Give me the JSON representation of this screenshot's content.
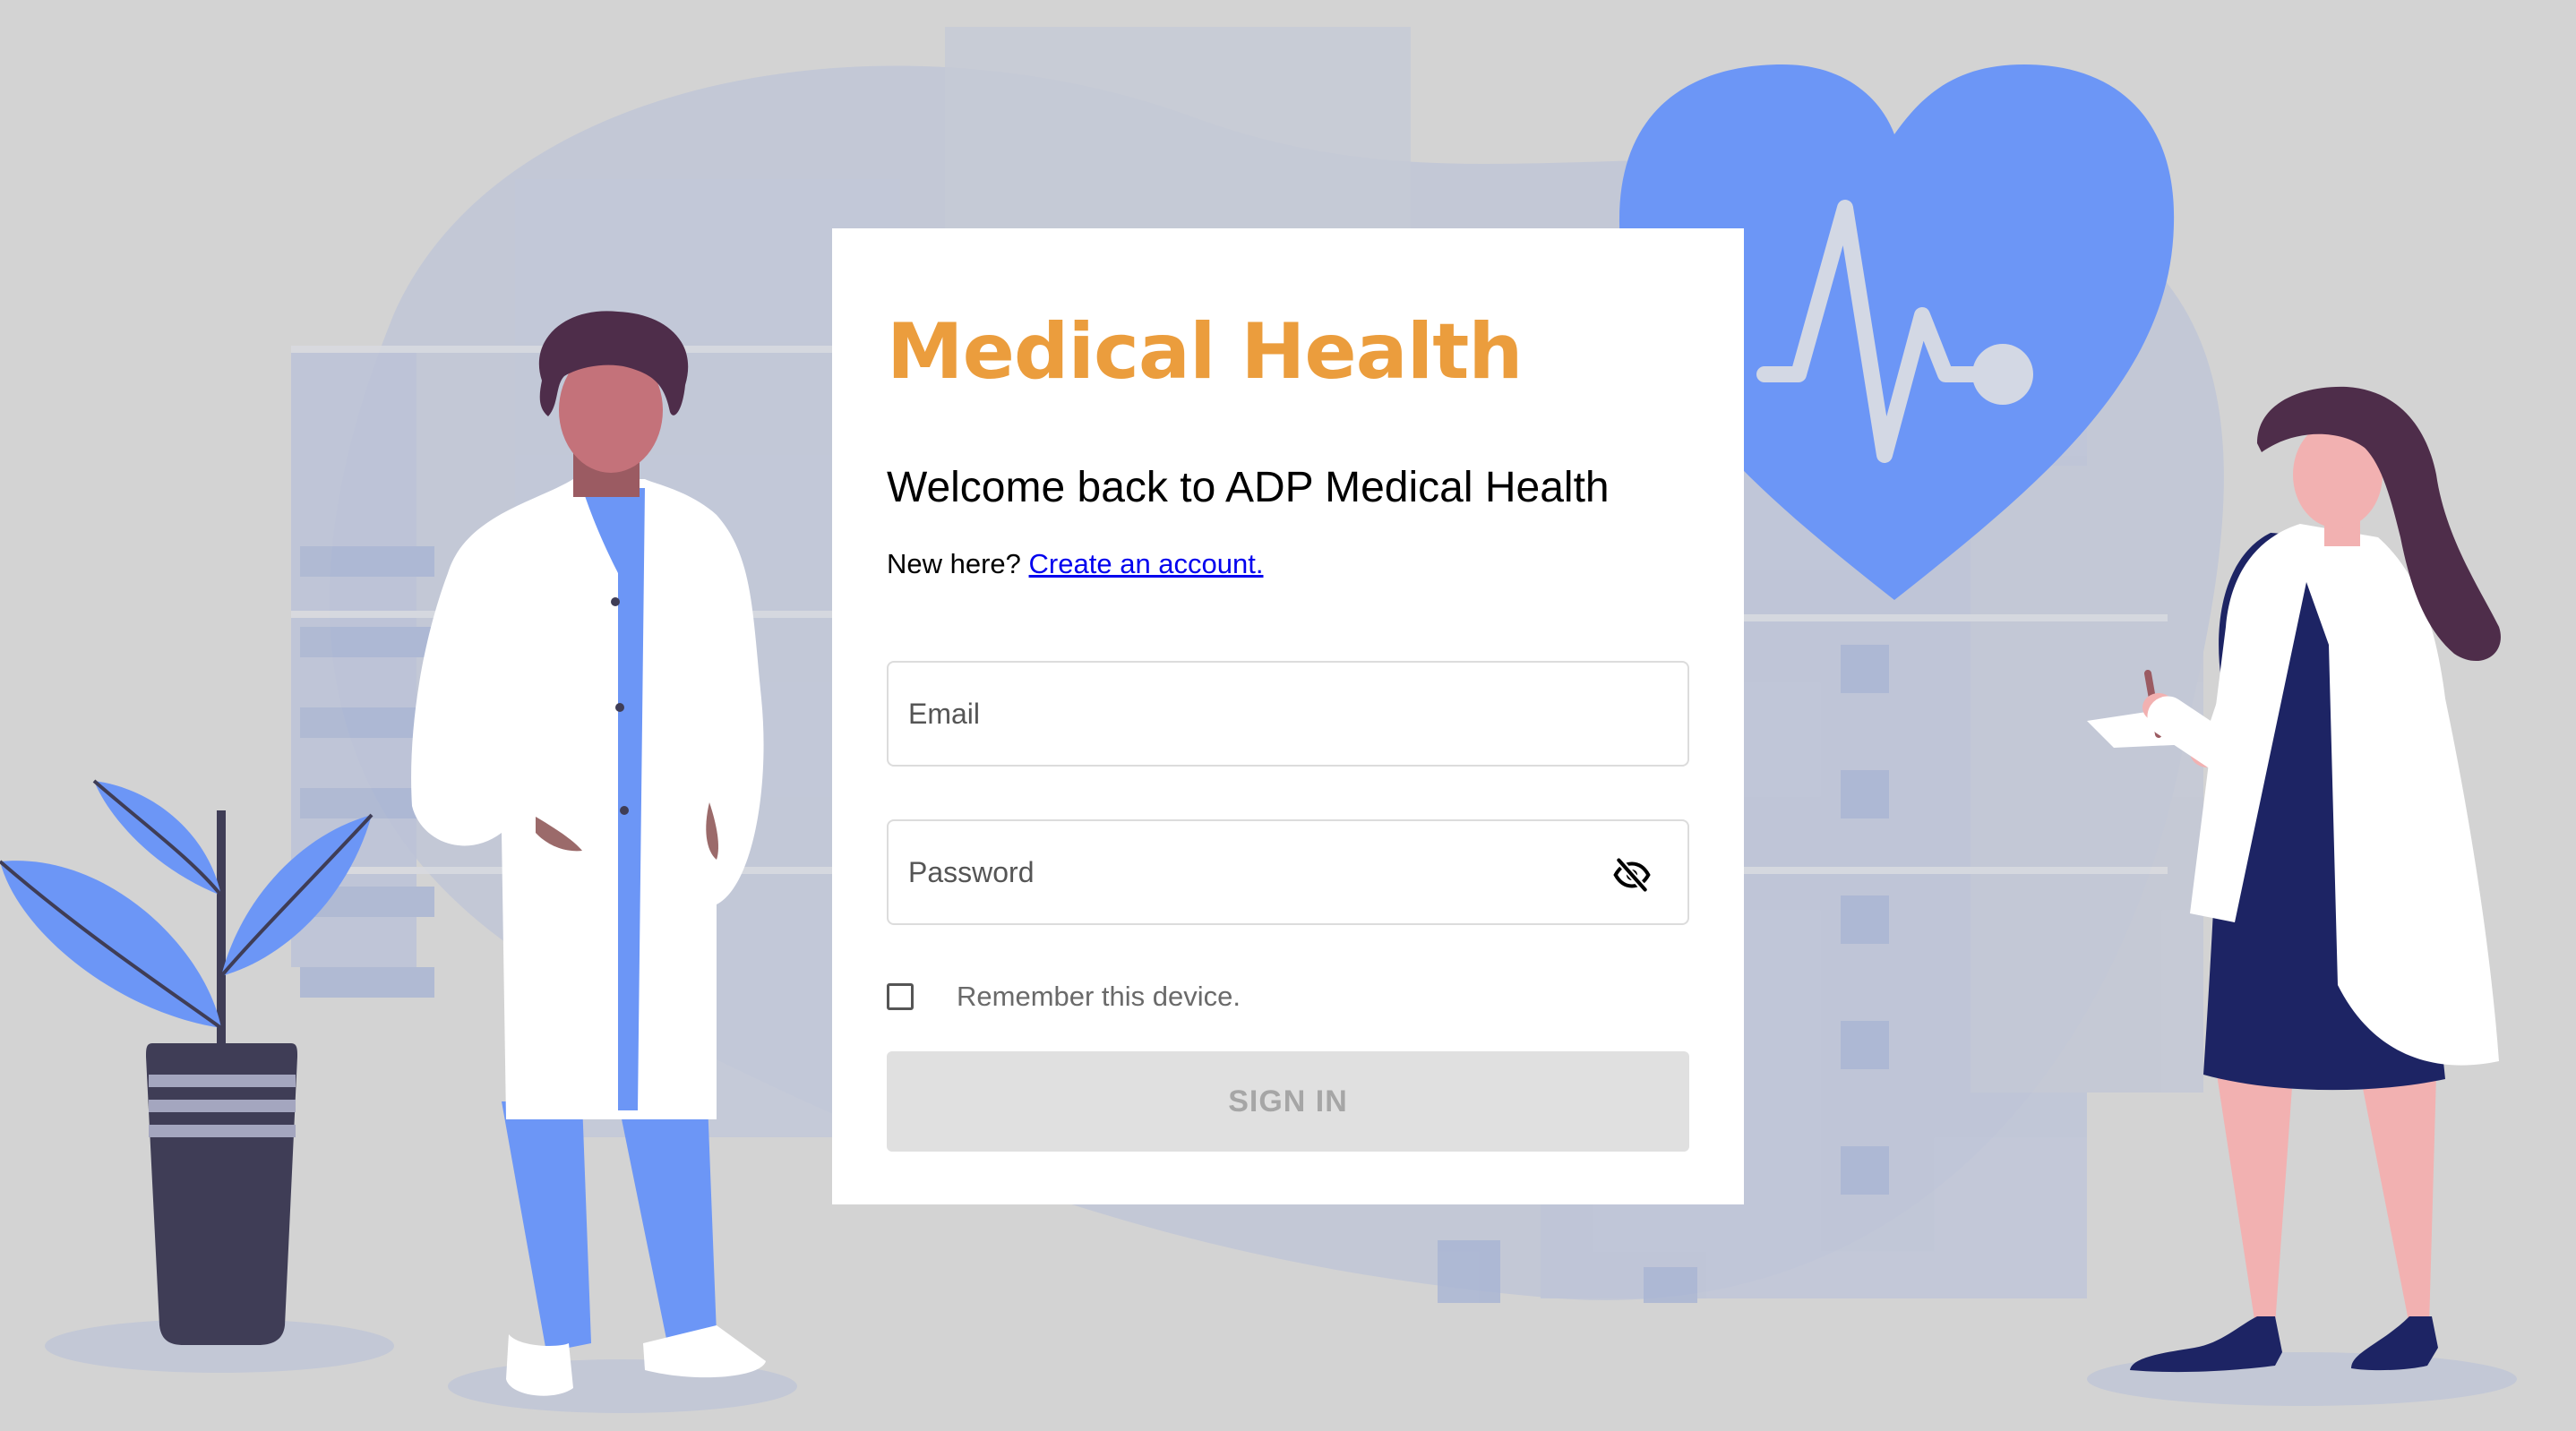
{
  "colors": {
    "background": "#d3d3d3",
    "brand": "#eb9d3d",
    "heart": "#6c96f6",
    "link": "#0000ee",
    "button_disabled_bg": "#e0e0e0",
    "button_disabled_text": "#a6a6a6",
    "scrub_top": "#6c96f6",
    "coat": "#ffffff",
    "dress": "#1d2464",
    "hair": "#4e2d4a",
    "planter": "#3f3d56"
  },
  "brand": {
    "title": "Medical Health"
  },
  "login": {
    "heading": "Welcome back to ADP Medical Health",
    "new_here": "New here?",
    "create_account": "Create an account.",
    "email_placeholder": "Email",
    "password_placeholder": "Password",
    "password_toggle_icon": "eye-off-icon",
    "remember_label": "Remember this device.",
    "remember_checked": false,
    "sign_in_label": "SIGN IN",
    "sign_in_enabled": false
  },
  "illustration": {
    "items": [
      "heart-pulse-icon",
      "doctor-male",
      "doctor-female",
      "potted-plant",
      "hospital-building"
    ]
  }
}
